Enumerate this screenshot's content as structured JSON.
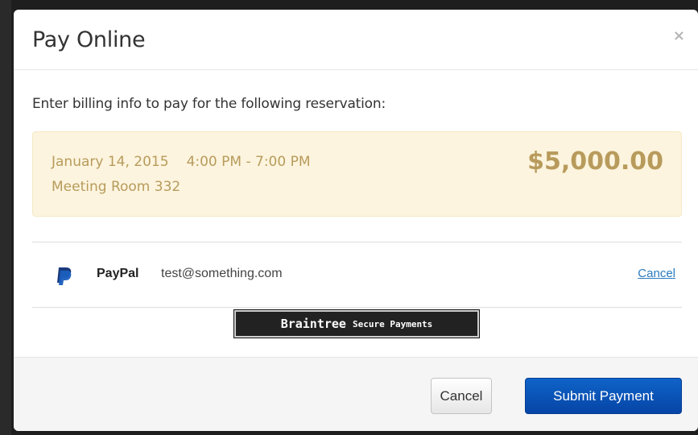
{
  "modal": {
    "title": "Pay Online",
    "close_label": "×",
    "intro": "Enter billing info to pay for the following reservation:"
  },
  "reservation": {
    "date": "January 14, 2015",
    "time": "4:00 PM - 7:00 PM",
    "room": "Meeting Room 332",
    "amount": "$5,000.00"
  },
  "payment_method": {
    "provider": "PayPal",
    "email": "test@something.com",
    "cancel_label": "Cancel",
    "icon": "paypal-icon"
  },
  "badge": {
    "name": "Braintree",
    "subtitle": "Secure Payments"
  },
  "footer": {
    "cancel_label": "Cancel",
    "submit_label": "Submit Payment"
  },
  "colors": {
    "reservation_bg": "#fcf4de",
    "reservation_text": "#b89b5c",
    "submit_button": "#0a56b8",
    "link": "#2b7bc0"
  }
}
